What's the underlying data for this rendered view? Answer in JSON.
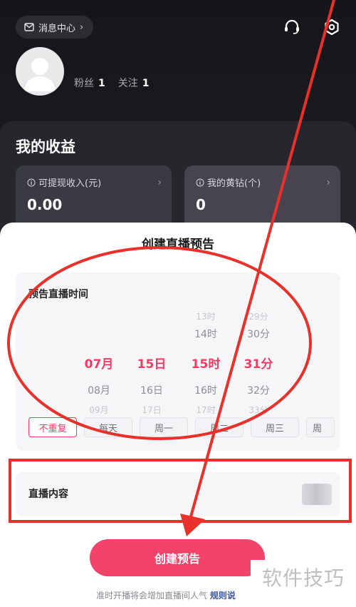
{
  "header": {
    "message_center_label": "消息中心",
    "followers_label": "粉丝",
    "followers_count": "1",
    "following_label": "关注",
    "following_count": "1",
    "icons": [
      "headset-icon",
      "settings-icon"
    ]
  },
  "earnings": {
    "title": "我的收益",
    "cards": [
      {
        "label": "可提现收入(元)",
        "value": "0.00"
      },
      {
        "label": "我的黄钻(个)",
        "value": "0"
      }
    ]
  },
  "sheet": {
    "title": "创建直播预告",
    "time_label": "预告直播时间",
    "picker": {
      "month": {
        "selected": "07月",
        "next": "08月",
        "next2": "09月"
      },
      "day": {
        "selected": "15日",
        "next": "16日",
        "next2": "17日"
      },
      "hour": {
        "prev2": "13时",
        "prev": "14时",
        "selected": "15时",
        "next": "16时",
        "next2": "17时"
      },
      "minute": {
        "prev2": "29分",
        "prev": "30分",
        "selected": "31分",
        "next": "32分",
        "next2": "33分"
      }
    },
    "repeat_options": [
      "不重复",
      "每天",
      "周一",
      "周二",
      "周三",
      "周"
    ],
    "repeat_selected": "不重复",
    "content_label": "直播内容",
    "create_button": "创建预告",
    "footer_note": "准时开播将会增加直播间人气",
    "footer_link": "规则说"
  },
  "annotations": {
    "color": "#e8312a"
  },
  "watermark": "软件技巧",
  "colors": {
    "accent": "#f13a64",
    "dark_bg": "#16161a"
  }
}
